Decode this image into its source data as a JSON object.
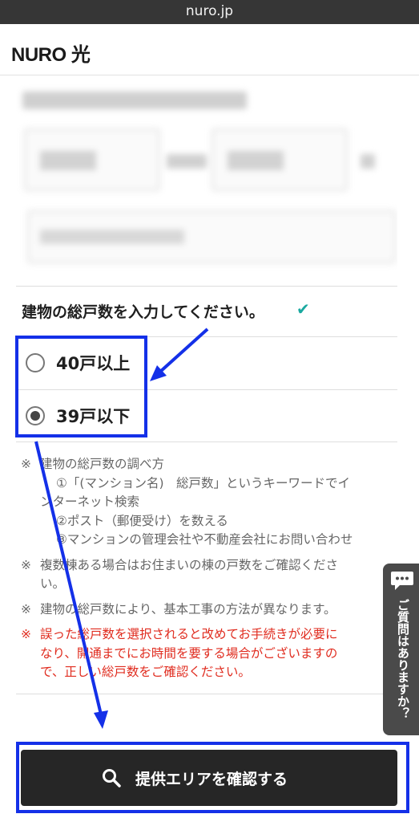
{
  "browser": {
    "url": "nuro.jp"
  },
  "header": {
    "logo": "NURO 光"
  },
  "question": {
    "label": "建物の総戸数を入力してください。",
    "check_icon": "✔"
  },
  "options": [
    {
      "label": "40戸以上",
      "selected": false
    },
    {
      "label": "39戸以下",
      "selected": true
    }
  ],
  "notes": {
    "mark": "※",
    "how_to_title": "建物の総戸数の調べ方",
    "how_to_1a": "①「(マンション名)　総戸数」というキーワードでイ",
    "how_to_1b": "ンターネット検索",
    "how_to_2": "②ポスト（郵便受け）を数える",
    "how_to_3": "③マンションの管理会社や不動産会社にお問い合わせ",
    "multi_building_a": "複数棟ある場合はお住まいの棟の戸数をご確認くださ",
    "multi_building_b": "い。",
    "construction": "建物の総戸数により、基本工事の方法が異なります。",
    "warning_a": "誤った総戸数を選択されると改めてお手続きが必要に",
    "warning_b": "なり、開通までにお時間を要する場合がございますの",
    "warning_c": "で、正しい総戸数をご確認ください。"
  },
  "cta": {
    "label": "提供エリアを確認する",
    "icon": "search-icon"
  },
  "chat": {
    "label": "ご質問はありますか？",
    "icon": "chat-bubble-icon"
  },
  "colors": {
    "accent_check": "#1aa9a0",
    "warning_text": "#e02c1f",
    "cta_bg": "#262626",
    "annotation": "#1430e8"
  }
}
